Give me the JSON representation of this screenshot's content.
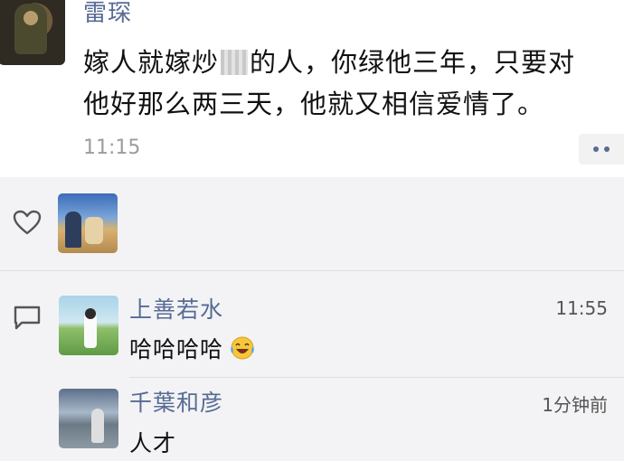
{
  "post": {
    "author": "雷琛",
    "text_part1": "嫁人就嫁炒",
    "text_part2": "的人，你绿他三年，只要对他好那么两三天，他就又相信爱情了。",
    "time": "11:15"
  },
  "icons": {
    "like": "heart-icon",
    "comment": "comment-icon",
    "more": "more-dots-icon",
    "emoji": "tears-of-joy-emoji"
  },
  "comments": [
    {
      "name": "上善若水",
      "time": "11:55",
      "text": "哈哈哈哈"
    },
    {
      "name": "千葉和彦",
      "time": "1分钟前",
      "text": "人才"
    }
  ],
  "colors": {
    "name_link": "#576b95",
    "panel_bg": "#f3f3f5",
    "time_gray": "#9c9c9c"
  }
}
